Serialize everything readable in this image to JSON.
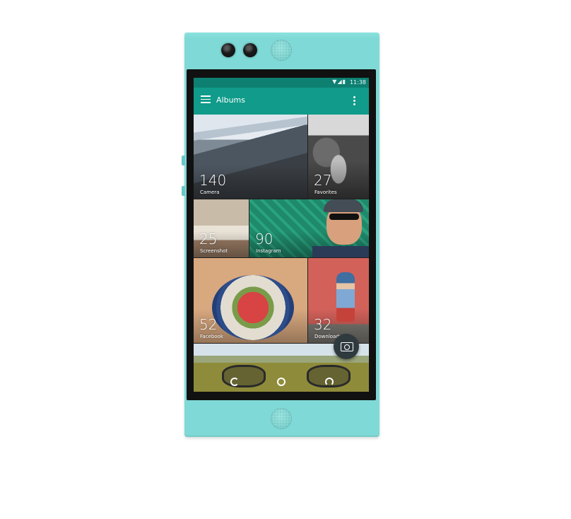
{
  "statusbar": {
    "time": "11:38",
    "icons": [
      "wifi-icon",
      "signal-icon",
      "battery-icon"
    ]
  },
  "appbar": {
    "title": "Albums",
    "menu_icon": "hamburger-menu-icon",
    "overflow_icon": "more-vert-icon"
  },
  "albums": [
    {
      "count": "140",
      "label": "Camera"
    },
    {
      "count": "27",
      "label": "Favorites"
    },
    {
      "count": "25",
      "label": "Screenshot"
    },
    {
      "count": "90",
      "label": "Instagram"
    },
    {
      "count": "52",
      "label": "Facebook"
    },
    {
      "count": "32",
      "label": "Downloads"
    }
  ],
  "fab": {
    "icon": "camera-icon"
  },
  "navbar": {
    "icons": [
      "back-icon",
      "home-icon",
      "recents-icon"
    ]
  },
  "colors": {
    "phone_body": "#7fd9d6",
    "status_bar": "#0d8072",
    "app_bar": "#109b8a",
    "fab": "#2f3a3f"
  }
}
